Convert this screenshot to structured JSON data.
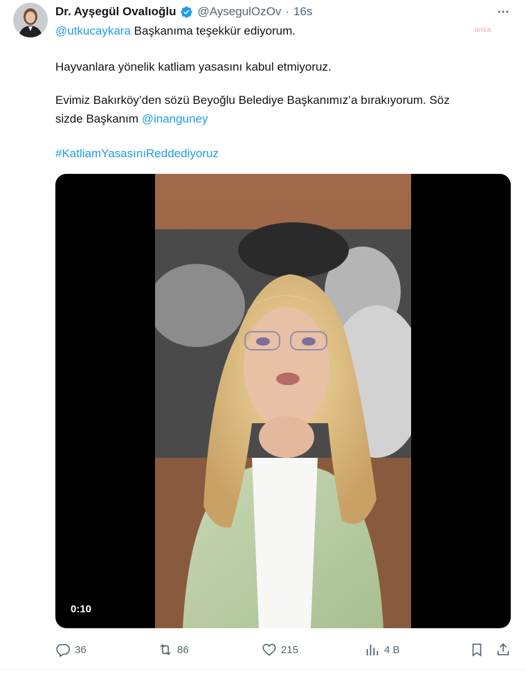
{
  "author": {
    "name": "Dr. Ayşegül Ovalıoğlu",
    "handle": "@AysegulOzOv",
    "separator": "·",
    "time": "16s",
    "verified": true,
    "avatar_icon": "profile-photo"
  },
  "watermark": "anka",
  "body": {
    "line1": {
      "mention": "@utkucaykara",
      "text": " Başkanıma teşekkür ediyorum."
    },
    "line2": "Hayvanlara yönelik katliam yasasını kabul etmiyoruz.",
    "line3": "Evimiz Bakırköy’den sözü Beyoğlu Belediye Başkanımız’a bırakıyorum. Söz",
    "line4": {
      "text": "sizde Başkanım ",
      "mention": "@inanguney"
    },
    "hashtag": "#KatliamYasasınıReddediyoruz"
  },
  "media": {
    "type": "video",
    "timecode": "0:10"
  },
  "actions": {
    "reply_count": "36",
    "retweet_count": "86",
    "like_count": "215",
    "views_count": "4 B"
  },
  "colors": {
    "accent": "#1d9bf0",
    "text": "#0f1419",
    "muted": "#536471"
  }
}
